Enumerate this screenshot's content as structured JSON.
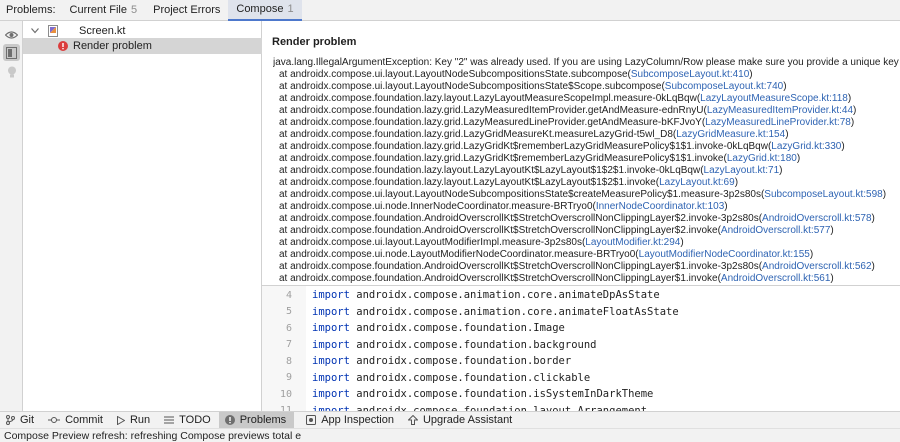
{
  "problems_panel": {
    "label": "Problems:",
    "tabs": [
      {
        "label": "Current File",
        "count": "5"
      },
      {
        "label": "Project Errors",
        "count": ""
      },
      {
        "label": "Compose",
        "count": "1"
      }
    ]
  },
  "tree": {
    "file": "Screen.kt",
    "problem": "Render problem"
  },
  "detail": {
    "title": "Render problem",
    "exception": "java.lang.IllegalArgumentException: Key \"2\" was already used. If you are using LazyColumn/Row please make sure you provide a unique key for each item.",
    "trace": [
      {
        "text": "at androidx.compose.ui.layout.LayoutNodeSubcompositionsState.subcompose(",
        "src": "SubcomposeLayout.kt:410"
      },
      {
        "text": "at androidx.compose.ui.layout.LayoutNodeSubcompositionsState$Scope.subcompose(",
        "src": "SubcomposeLayout.kt:740"
      },
      {
        "text": "at androidx.compose.foundation.lazy.layout.LazyLayoutMeasureScopeImpl.measure-0kLqBqw(",
        "src": "LazyLayoutMeasureScope.kt:118"
      },
      {
        "text": "at androidx.compose.foundation.lazy.grid.LazyMeasuredItemProvider.getAndMeasure-ednRnyU(",
        "src": "LazyMeasuredItemProvider.kt:44"
      },
      {
        "text": "at androidx.compose.foundation.lazy.grid.LazyMeasuredLineProvider.getAndMeasure-bKFJvoY(",
        "src": "LazyMeasuredLineProvider.kt:78"
      },
      {
        "text": "at androidx.compose.foundation.lazy.grid.LazyGridMeasureKt.measureLazyGrid-t5wl_D8(",
        "src": "LazyGridMeasure.kt:154"
      },
      {
        "text": "at androidx.compose.foundation.lazy.grid.LazyGridKt$rememberLazyGridMeasurePolicy$1$1.invoke-0kLqBqw(",
        "src": "LazyGrid.kt:330"
      },
      {
        "text": "at androidx.compose.foundation.lazy.grid.LazyGridKt$rememberLazyGridMeasurePolicy$1$1.invoke(",
        "src": "LazyGrid.kt:180"
      },
      {
        "text": "at androidx.compose.foundation.lazy.layout.LazyLayoutKt$LazyLayout$1$2$1.invoke-0kLqBqw(",
        "src": "LazyLayout.kt:71"
      },
      {
        "text": "at androidx.compose.foundation.lazy.layout.LazyLayoutKt$LazyLayout$1$2$1.invoke(",
        "src": "LazyLayout.kt:69"
      },
      {
        "text": "at androidx.compose.ui.layout.LayoutNodeSubcompositionsState$createMeasurePolicy$1.measure-3p2s80s(",
        "src": "SubcomposeLayout.kt:598"
      },
      {
        "text": "at androidx.compose.ui.node.InnerNodeCoordinator.measure-BRTryo0(",
        "src": "InnerNodeCoordinator.kt:103"
      },
      {
        "text": "at androidx.compose.foundation.AndroidOverscrollKt$StretchOverscrollNonClippingLayer$2.invoke-3p2s80s(",
        "src": "AndroidOverscroll.kt:578"
      },
      {
        "text": "at androidx.compose.foundation.AndroidOverscrollKt$StretchOverscrollNonClippingLayer$2.invoke(",
        "src": "AndroidOverscroll.kt:577"
      },
      {
        "text": "at androidx.compose.ui.layout.LayoutModifierImpl.measure-3p2s80s(",
        "src": "LayoutModifier.kt:294"
      },
      {
        "text": "at androidx.compose.ui.node.LayoutModifierNodeCoordinator.measure-BRTryo0(",
        "src": "LayoutModifierNodeCoordinator.kt:155"
      },
      {
        "text": "at androidx.compose.foundation.AndroidOverscrollKt$StretchOverscrollNonClippingLayer$1.invoke-3p2s80s(",
        "src": "AndroidOverscroll.kt:562"
      },
      {
        "text": "at androidx.compose.foundation.AndroidOverscrollKt$StretchOverscrollNonClippingLayer$1.invoke(",
        "src": "AndroidOverscroll.kt:561"
      }
    ]
  },
  "editor": {
    "lines": [
      {
        "num": "4",
        "kw": "import",
        "code": "androidx.compose.animation.core.animateDpAsState"
      },
      {
        "num": "5",
        "kw": "import",
        "code": "androidx.compose.animation.core.animateFloatAsState"
      },
      {
        "num": "6",
        "kw": "import",
        "code": "androidx.compose.foundation.Image"
      },
      {
        "num": "7",
        "kw": "import",
        "code": "androidx.compose.foundation.background"
      },
      {
        "num": "8",
        "kw": "import",
        "code": "androidx.compose.foundation.border"
      },
      {
        "num": "9",
        "kw": "import",
        "code": "androidx.compose.foundation.clickable"
      },
      {
        "num": "10",
        "kw": "import",
        "code": "androidx.compose.foundation.isSystemInDarkTheme"
      },
      {
        "num": "11",
        "kw": "import",
        "code": "androidx.compose.foundation.layout.Arrangement"
      }
    ]
  },
  "toolwindows": [
    {
      "label": "Git",
      "icon": "git-branch-icon"
    },
    {
      "label": "Commit",
      "icon": "commit-icon"
    },
    {
      "label": "Run",
      "icon": "run-icon"
    },
    {
      "label": "TODO",
      "icon": "todo-icon"
    },
    {
      "label": "Problems",
      "icon": "problems-icon"
    },
    {
      "label": "App Inspection",
      "icon": "app-inspection-icon"
    },
    {
      "label": "Upgrade Assistant",
      "icon": "upgrade-assistant-icon"
    }
  ],
  "status": {
    "text": "Compose Preview refresh: refreshing Compose previews total e"
  },
  "colors": {
    "accent": "#4d78cc",
    "link": "#2f64b3",
    "error": "#db3b3b",
    "keyword": "#0033b3",
    "selected_row": "#d5d5d5"
  }
}
